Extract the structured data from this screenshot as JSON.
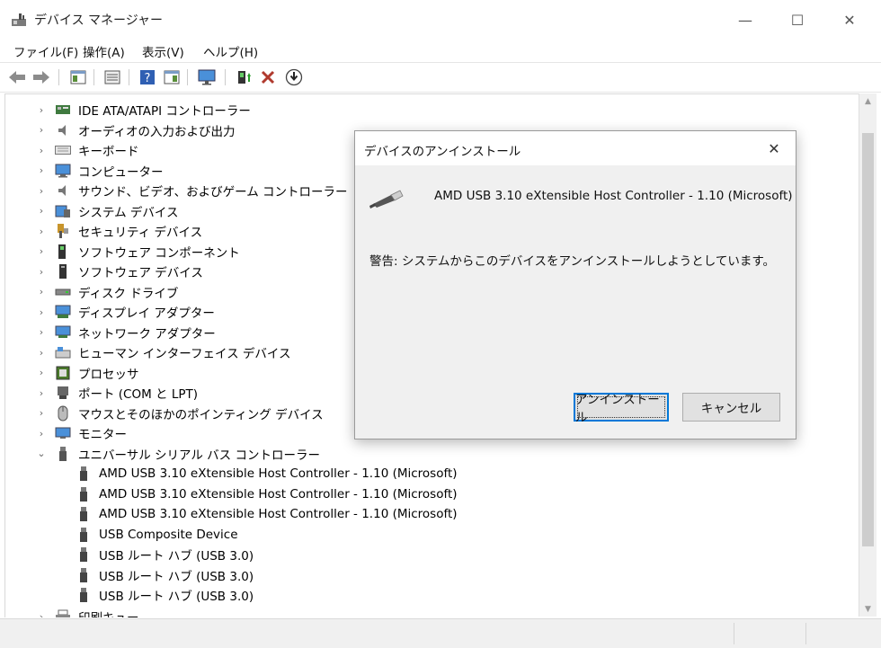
{
  "window": {
    "title": "デバイス マネージャー",
    "controls": {
      "minimize": "—",
      "maximize": "☐",
      "close": "✕"
    }
  },
  "menu": [
    "ファイル(F)",
    "操作(A)",
    "表示(V)",
    "ヘルプ(H)"
  ],
  "toolbar": [
    "back-icon",
    "forward-icon",
    "properties-icon",
    "view-icon",
    "help-icon",
    "details-icon",
    "monitor-icon",
    "add-driver-icon",
    "uninstall-icon",
    "download-icon"
  ],
  "tree": {
    "categories": [
      {
        "label": "IDE ATA/ATAPI コントローラー",
        "icon": "ide-controller-icon",
        "expanded": false
      },
      {
        "label": "オーディオの入力および出力",
        "icon": "speaker-icon",
        "expanded": false
      },
      {
        "label": "キーボード",
        "icon": "keyboard-icon",
        "expanded": false
      },
      {
        "label": "コンピューター",
        "icon": "computer-icon",
        "expanded": false
      },
      {
        "label": "サウンド、ビデオ、およびゲーム コントローラー",
        "icon": "speaker-icon",
        "expanded": false
      },
      {
        "label": "システム デバイス",
        "icon": "system-devices-icon",
        "expanded": false
      },
      {
        "label": "セキュリティ デバイス",
        "icon": "security-key-icon",
        "expanded": false
      },
      {
        "label": "ソフトウェア コンポーネント",
        "icon": "software-component-icon",
        "expanded": false
      },
      {
        "label": "ソフトウェア デバイス",
        "icon": "software-device-icon",
        "expanded": false
      },
      {
        "label": "ディスク ドライブ",
        "icon": "disk-drive-icon",
        "expanded": false
      },
      {
        "label": "ディスプレイ アダプター",
        "icon": "display-adapter-icon",
        "expanded": false
      },
      {
        "label": "ネットワーク アダプター",
        "icon": "network-adapter-icon",
        "expanded": false
      },
      {
        "label": "ヒューマン インターフェイス デバイス",
        "icon": "hid-icon",
        "expanded": false
      },
      {
        "label": "プロセッサ",
        "icon": "processor-icon",
        "expanded": false
      },
      {
        "label": "ポート (COM と LPT)",
        "icon": "port-icon",
        "expanded": false
      },
      {
        "label": "マウスとそのほかのポインティング デバイス",
        "icon": "mouse-icon",
        "expanded": false
      },
      {
        "label": "モニター",
        "icon": "monitor-icon",
        "expanded": false
      },
      {
        "label": "ユニバーサル シリアル バス コントローラー",
        "icon": "usb-icon",
        "expanded": true
      },
      {
        "label": "印刷キュー",
        "icon": "printer-icon",
        "expanded": false
      }
    ],
    "usb_children": [
      "AMD USB 3.10 eXtensible Host Controller - 1.10 (Microsoft)",
      "AMD USB 3.10 eXtensible Host Controller - 1.10 (Microsoft)",
      "AMD USB 3.10 eXtensible Host Controller - 1.10 (Microsoft)",
      "USB Composite Device",
      "USB ルート ハブ (USB 3.0)",
      "USB ルート ハブ (USB 3.0)",
      "USB ルート ハブ (USB 3.0)"
    ]
  },
  "dialog": {
    "title": "デバイスのアンインストール",
    "device_name": "AMD USB 3.10 eXtensible Host Controller - 1.10 (Microsoft)",
    "warning": "警告: システムからこのデバイスをアンインストールしようとしています。",
    "uninstall_label": "アンインストール",
    "cancel_label": "キャンセル",
    "accent": "#0078d7"
  }
}
